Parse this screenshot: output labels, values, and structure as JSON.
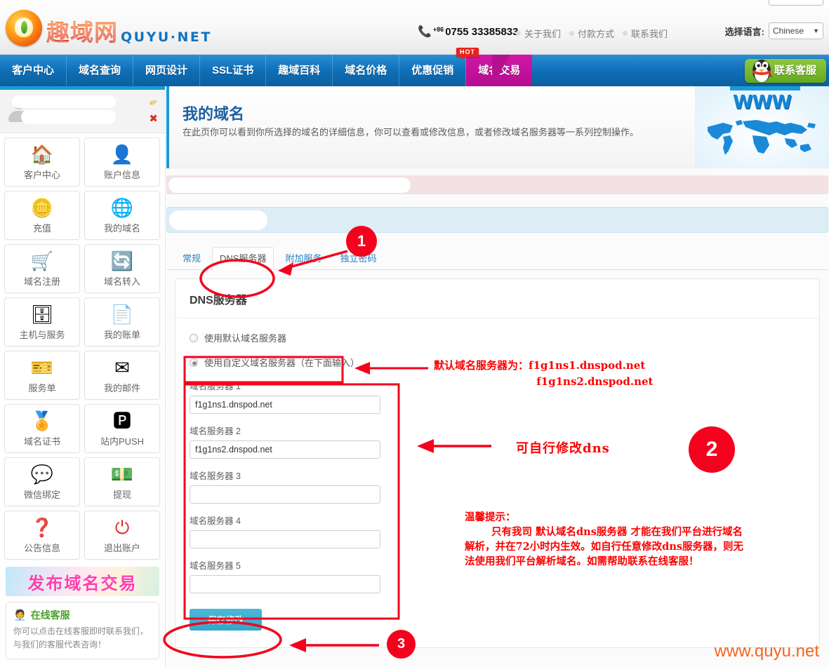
{
  "header": {
    "logo_text": "趣域网",
    "logo_sub": "QUYU·NET",
    "phone_cc": "+86",
    "phone": "0755 33385833",
    "links": [
      "关于我们",
      "付款方式",
      "联系我们"
    ],
    "lang_label": "选择语言:",
    "lang_value": "Chinese"
  },
  "nav": {
    "items": [
      "客户中心",
      "域名查询",
      "网页设计",
      "SSL证书",
      "趣域百科",
      "域名价格",
      "优惠促销",
      "域名交易"
    ],
    "active_index": 7,
    "hot_badge": "HOT",
    "qq_label": "联系客服"
  },
  "sidebar": {
    "tiles": [
      {
        "label": "客户中心",
        "icon": "house-icon",
        "glyph": "🏠"
      },
      {
        "label": "账户信息",
        "icon": "user-edit-icon",
        "glyph": "👤"
      },
      {
        "label": "充值",
        "icon": "coins-icon",
        "glyph": "🪙"
      },
      {
        "label": "我的域名",
        "icon": "globe-icon",
        "glyph": "🌐"
      },
      {
        "label": "域名注册",
        "icon": "cart-icon",
        "glyph": "🛒"
      },
      {
        "label": "域名转入",
        "icon": "transfer-icon",
        "glyph": "🔄"
      },
      {
        "label": "主机与服务",
        "icon": "server-icon",
        "glyph": "🗄"
      },
      {
        "label": "我的账单",
        "icon": "invoice-icon",
        "glyph": "📄"
      },
      {
        "label": "服务单",
        "icon": "ticket-icon",
        "glyph": "🎫"
      },
      {
        "label": "我的邮件",
        "icon": "mail-icon",
        "glyph": "✉"
      },
      {
        "label": "域名证书",
        "icon": "certificate-icon",
        "glyph": "🏅"
      },
      {
        "label": "站内PUSH",
        "icon": "push-icon",
        "glyph": "🅿"
      },
      {
        "label": "微信绑定",
        "icon": "wechat-icon",
        "glyph": "💬"
      },
      {
        "label": "提现",
        "icon": "money-icon",
        "glyph": "💵"
      },
      {
        "label": "公告信息",
        "icon": "question-icon",
        "glyph": "❓"
      },
      {
        "label": "退出账户",
        "icon": "power-icon",
        "glyph": "⏻"
      }
    ],
    "promo_banner": "发布域名交易",
    "service": {
      "title": "在线客服",
      "icon": "headset-agent-icon",
      "text": "你可以点击在线客服即时联系我们，与我们的客服代表咨询！"
    }
  },
  "main": {
    "banner_title": "我的域名",
    "banner_sub": "在此页你可以看到你所选择的域名的详细信息，你可以查看或修改信息，或者修改域名服务器等一系列控制操作。",
    "banner_art_text": "WWW",
    "tabs": [
      "常规",
      "DNS服务器",
      "附加服务",
      "独立密码"
    ],
    "active_tab_index": 1,
    "panel_title": "DNS服务器",
    "option_default": "使用默认域名服务器",
    "option_custom": "使用自定义域名服务器（在下面输入）",
    "selected_option": "custom",
    "nameservers": [
      {
        "label": "域名服务器 1",
        "value": "f1g1ns1.dnspod.net"
      },
      {
        "label": "域名服务器 2",
        "value": "f1g1ns2.dnspod.net"
      },
      {
        "label": "域名服务器 3",
        "value": ""
      },
      {
        "label": "域名服务器 4",
        "value": ""
      },
      {
        "label": "域名服务器 5",
        "value": ""
      }
    ],
    "save_label": "保存修改"
  },
  "annotations": {
    "badge_1": "1",
    "badge_2": "2",
    "badge_3": "3",
    "default_ns_note": "默认域名服务器为：f1g1ns1.dnspod.net\n                            f1g1ns2.dnspod.net",
    "edit_dns_note": "可自行修改dns",
    "tip_title": "温馨提示：",
    "tip_body": "只有我司 默认域名dns服务器 才能在我们平台进行域名解析，并在72小时内生效。如自行任意修改dns服务器，则无法使用我们平台解析域名。如需帮助联系在线客服！",
    "accent_color": "#fc0000"
  },
  "watermark": "www.quyu.net"
}
